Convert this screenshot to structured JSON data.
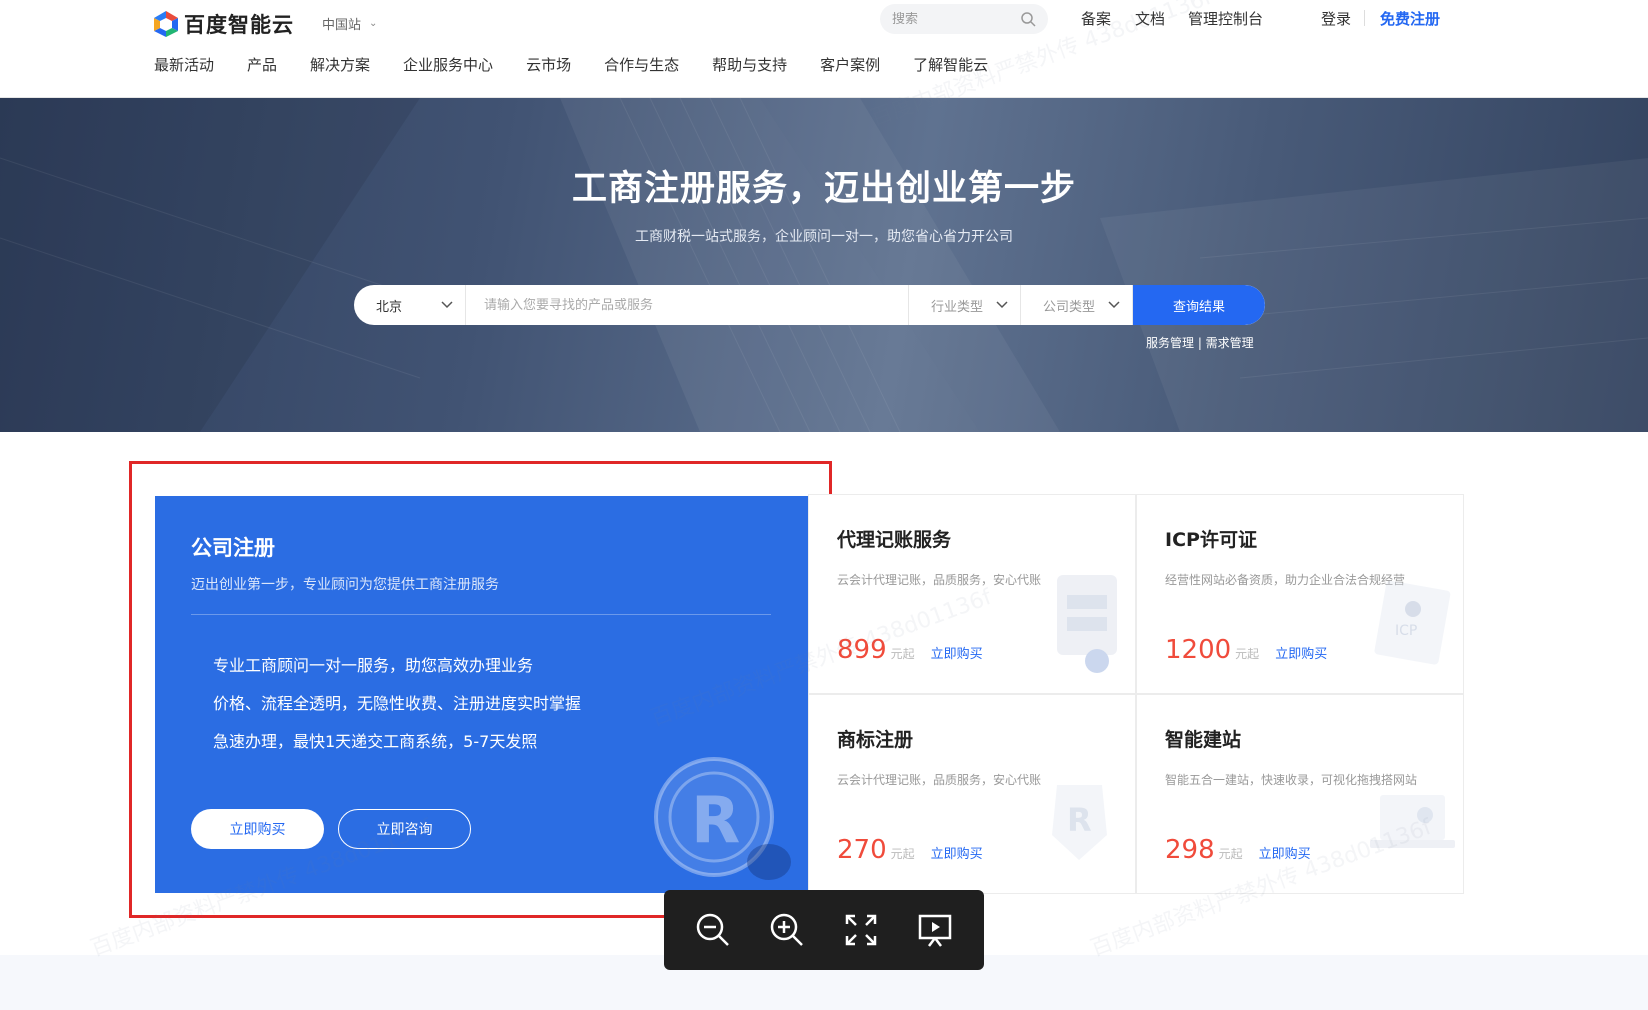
{
  "header": {
    "logo_text": "百度智能云",
    "region": "中国站",
    "search_placeholder": "搜索",
    "links": {
      "beian": "备案",
      "docs": "文档",
      "console": "管理控制台",
      "login": "登录",
      "register": "免费注册"
    },
    "nav": [
      "最新活动",
      "产品",
      "解决方案",
      "企业服务中心",
      "云市场",
      "合作与生态",
      "帮助与支持",
      "客户案例",
      "了解智能云"
    ]
  },
  "hero": {
    "title": "工商注册服务，迈出创业第一步",
    "subtitle": "工商财税一站式服务，企业顾问一对一，助您省心省力开公司",
    "search": {
      "city": "北京",
      "placeholder": "请输入您要寻找的产品或服务",
      "industry": "行业类型",
      "company_type": "公司类型",
      "button": "查询结果"
    },
    "links": "服务管理 | 需求管理"
  },
  "feature": {
    "title": "公司注册",
    "subtitle": "迈出创业第一步，专业顾问为您提供工商注册服务",
    "bullets": [
      "专业工商顾问一对一服务，助您高效办理业务",
      "价格、流程全透明，无隐性收费、注册进度实时掌握",
      "急速办理，最快1天递交工商系统，5-7天发照"
    ],
    "buy_label": "立即购买",
    "consult_label": "立即咨询"
  },
  "cards": [
    {
      "title": "代理记账服务",
      "desc": "云会计代理记账，品质服务，安心代账",
      "price": "899",
      "unit": "元起",
      "buy": "立即购买"
    },
    {
      "title": "ICP许可证",
      "desc": "经营性网站必备资质，助力企业合法合规经营",
      "price": "1200",
      "unit": "元起",
      "buy": "立即购买"
    },
    {
      "title": "商标注册",
      "desc": "云会计代理记账，品质服务，安心代账",
      "price": "270",
      "unit": "元起",
      "buy": "立即购买"
    },
    {
      "title": "智能建站",
      "desc": "智能五合一建站，快速收录，可视化拖拽搭网站",
      "price": "298",
      "unit": "元起",
      "buy": "立即购买"
    }
  ],
  "watermark": "百度内部资料严禁外传 438d01136f",
  "colors": {
    "brand_blue": "#2468f2",
    "feature_blue": "#2b6de3",
    "price_red": "#f04b3b",
    "highlight_red": "#e02727"
  },
  "viewer_toolbar": [
    "zoom-out-icon",
    "zoom-in-icon",
    "fullscreen-icon",
    "presentation-icon"
  ]
}
